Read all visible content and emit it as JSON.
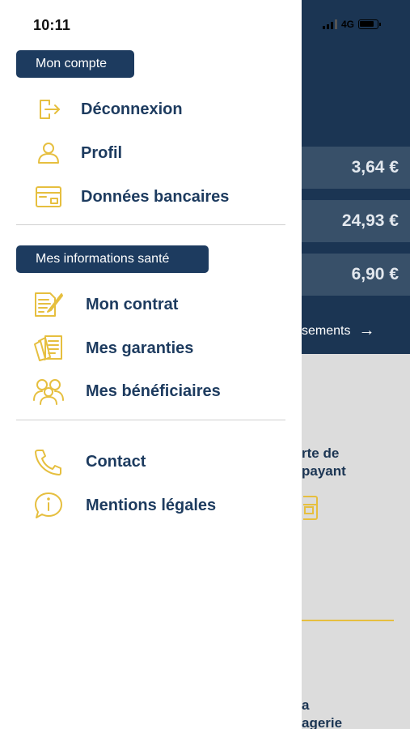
{
  "status_bar": {
    "time": "10:11",
    "network": "4G"
  },
  "drawer": {
    "sections": [
      {
        "title": "Mon compte",
        "items": [
          {
            "label": "Déconnexion",
            "icon": "logout-icon"
          },
          {
            "label": "Profil",
            "icon": "user-icon"
          },
          {
            "label": "Données bancaires",
            "icon": "bank-card-icon"
          }
        ]
      },
      {
        "title": "Mes informations santé",
        "items": [
          {
            "label": "Mon contrat",
            "icon": "contract-icon"
          },
          {
            "label": "Mes garanties",
            "icon": "documents-icon"
          },
          {
            "label": "Mes bénéficiaires",
            "icon": "people-icon"
          }
        ]
      },
      {
        "title": "",
        "items": [
          {
            "label": "Contact",
            "icon": "phone-icon"
          },
          {
            "label": "Mentions légales",
            "icon": "info-icon"
          }
        ]
      }
    ]
  },
  "background_app": {
    "amounts": [
      "3,64 €",
      "24,93 €",
      "6,90 €"
    ],
    "reimbursements_link": "sements",
    "card_label_1": "rte de",
    "card_label_2": "payant",
    "card_label_3": "a",
    "card_label_4": "agerie"
  },
  "colors": {
    "navy": "#1d3b5f",
    "gold": "#e6bf3f",
    "divider": "#cfcfcf"
  }
}
